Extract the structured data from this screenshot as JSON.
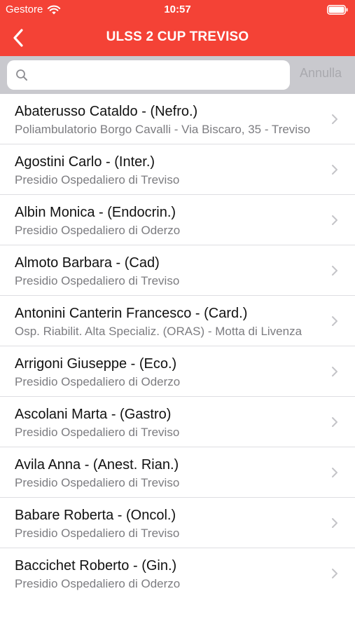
{
  "status_bar": {
    "carrier": "Gestore",
    "time": "10:57"
  },
  "nav": {
    "title": "ULSS 2 CUP TREVISO"
  },
  "search": {
    "placeholder": "",
    "value": "",
    "cancel_label": "Annulla"
  },
  "list": {
    "items": [
      {
        "name": "Abaterusso Cataldo - (Nefro.)",
        "location": "Poliambulatorio Borgo Cavalli - Via Biscaro, 35 - Treviso"
      },
      {
        "name": "Agostini Carlo - (Inter.)",
        "location": "Presidio Ospedaliero di Treviso"
      },
      {
        "name": "Albin Monica - (Endocrin.)",
        "location": "Presidio Ospedaliero di Oderzo"
      },
      {
        "name": "Almoto Barbara - (Cad)",
        "location": "Presidio Ospedaliero di Treviso"
      },
      {
        "name": "Antonini Canterin Francesco - (Card.)",
        "location": "Osp. Riabilit. Alta Specializ. (ORAS) - Motta di Livenza"
      },
      {
        "name": "Arrigoni Giuseppe - (Eco.)",
        "location": "Presidio Ospedaliero di Oderzo"
      },
      {
        "name": "Ascolani Marta - (Gastro)",
        "location": "Presidio Ospedaliero di Treviso"
      },
      {
        "name": "Avila Anna - (Anest. Rian.)",
        "location": "Presidio Ospedaliero di Treviso"
      },
      {
        "name": "Babare Roberta - (Oncol.)",
        "location": "Presidio Ospedaliero di Treviso"
      },
      {
        "name": "Baccichet Roberto - (Gin.)",
        "location": "Presidio Ospedaliero di Oderzo"
      }
    ]
  },
  "colors": {
    "accent": "#f44236",
    "search_bar_background": "#c9c9ce",
    "subtitle_text": "#7c7c80",
    "chevron": "#c4c4c8"
  }
}
